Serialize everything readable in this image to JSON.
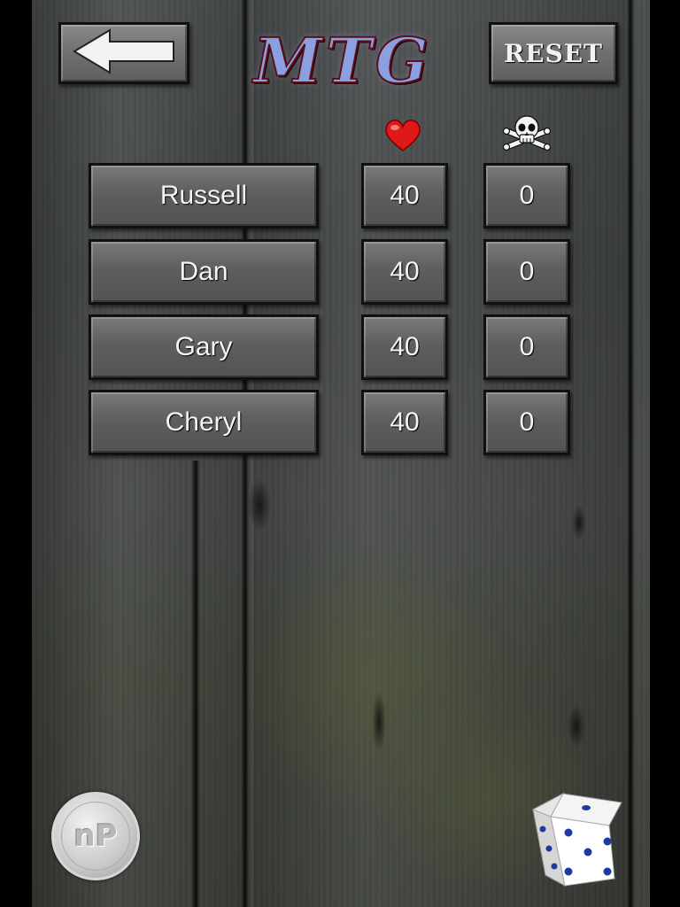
{
  "header": {
    "back_icon": "left-arrow-icon",
    "title": "MTG",
    "reset_label": "RESET"
  },
  "columns": {
    "life_icon": "heart-icon",
    "poison_icon": "skull-crossbones-icon"
  },
  "players": [
    {
      "name": "Russell",
      "life": "40",
      "poison": "0"
    },
    {
      "name": "Dan",
      "life": "40",
      "poison": "0"
    },
    {
      "name": "Gary",
      "life": "40",
      "poison": "0"
    },
    {
      "name": "Cheryl",
      "life": "40",
      "poison": "0"
    }
  ],
  "footer": {
    "badge_text": "nP",
    "dice_icon": "dice-icon"
  },
  "colors": {
    "title_fill": "#8aa0e0",
    "title_outline": "#5a1018",
    "heart": "#e01818",
    "button_face": "#5e5e5c"
  }
}
